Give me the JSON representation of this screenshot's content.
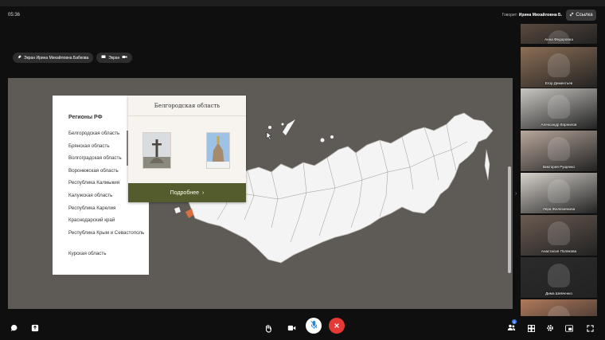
{
  "topbar": {
    "time": "05:36",
    "speaking_label": "Говорит:",
    "speaking_name": "Ирина Михайловна Б.",
    "link_label": "Ссылка"
  },
  "screenbar": {
    "presenter": "Экран Ирина Михайловна Бабкова",
    "screen_label": "Экран"
  },
  "regions_panel": {
    "title": "Регионы РФ",
    "items": [
      "Белгородская область",
      "Брянская область",
      "Волгоградская область",
      "Воронежская область",
      "Республика Калмыкия",
      "Калужская область",
      "Республика Карелия",
      "Краснодарский край",
      "Республика Крым и Севастополь",
      "Курская область"
    ]
  },
  "region_card": {
    "title": "Белгородская область",
    "more_label": "Подробнее"
  },
  "participants": [
    {
      "name": "Анна Федоровна",
      "tone": "#5a4a3f"
    },
    {
      "name": "Егор Дементьев",
      "tone": "#8c6f56"
    },
    {
      "name": "Александр Корнилов",
      "tone": "#c9c7c2"
    },
    {
      "name": "Виктория Рущенко",
      "tone": "#b8a79c"
    },
    {
      "name": "Лера Железнякова",
      "tone": "#d7d2cb"
    },
    {
      "name": "Анастасия Полякова",
      "tone": "#6b5b52"
    },
    {
      "name": "Дима Шевченко",
      "tone": "#2b2b2b"
    },
    {
      "name": "",
      "tone": "#b07a5c"
    }
  ],
  "colors": {
    "stage_bg": "#5e5b56",
    "card_button": "#545b2d",
    "highlight_region": "#d9703e",
    "end_call": "#e53935"
  },
  "icons": [
    "pin-icon",
    "link-icon",
    "screen-icon",
    "camera-icon",
    "chat-icon",
    "share-icon",
    "hand-icon",
    "video-icon",
    "mic-off-icon",
    "end-call-icon",
    "participants-icon",
    "grid-icon",
    "settings-icon",
    "layout-icon",
    "fullscreen-icon",
    "chevron-right-icon"
  ],
  "participants_count_badge": "5"
}
